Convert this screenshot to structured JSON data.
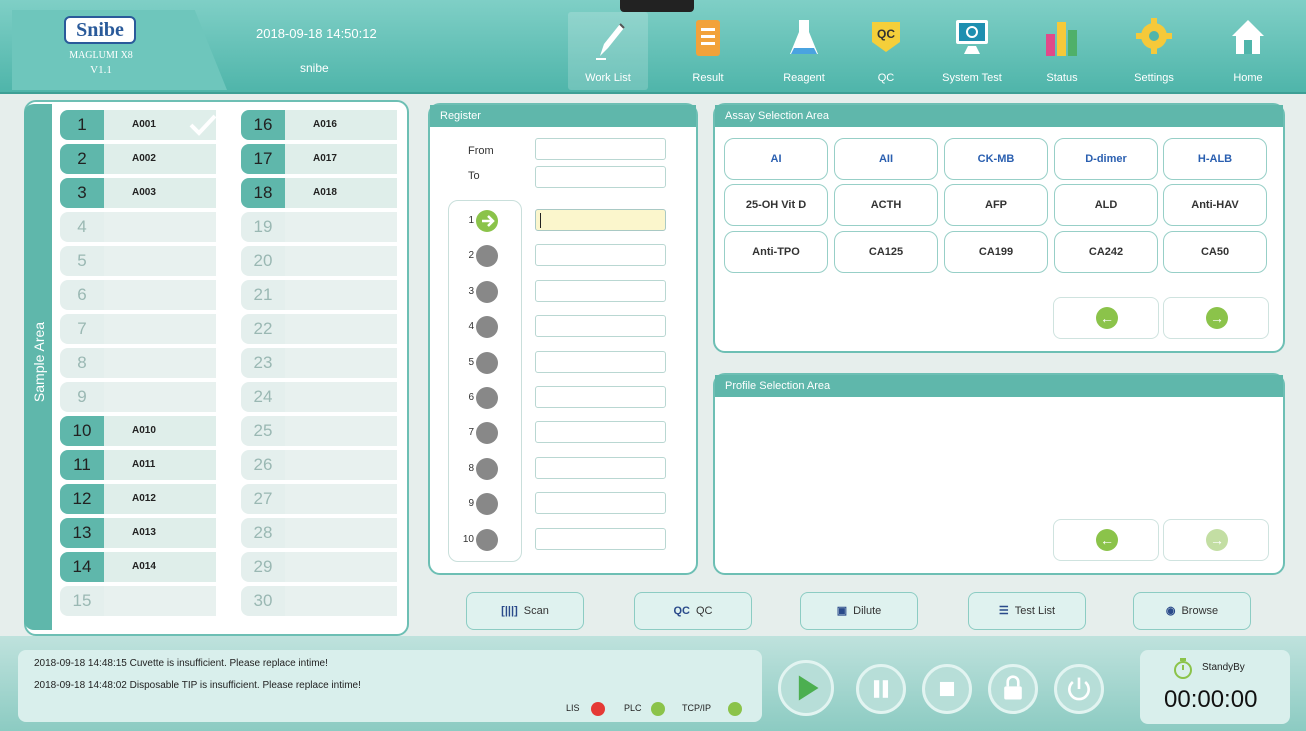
{
  "header": {
    "logo": "Snibe",
    "model": "MAGLUMI X8",
    "version": "V1.1",
    "datetime": "2018-09-18 14:50:12",
    "user": "snibe",
    "nav": [
      {
        "label": "Work List",
        "icon": "pencil-icon",
        "active": true
      },
      {
        "label": "Result",
        "icon": "document-icon"
      },
      {
        "label": "Reagent",
        "icon": "flask-icon"
      },
      {
        "label": "QC",
        "icon": "qc-badge-icon",
        "badge": "QC"
      },
      {
        "label": "System Test",
        "icon": "monitor-icon"
      },
      {
        "label": "Status",
        "icon": "bar-chart-icon"
      },
      {
        "label": "Settings",
        "icon": "gear-icon"
      },
      {
        "label": "Home",
        "icon": "home-icon"
      }
    ]
  },
  "sample_area": {
    "label": "Sample Area",
    "col1": [
      {
        "n": "1",
        "id": "A001",
        "checked": true
      },
      {
        "n": "2",
        "id": "A002"
      },
      {
        "n": "3",
        "id": "A003"
      },
      {
        "n": "4",
        "id": ""
      },
      {
        "n": "5",
        "id": ""
      },
      {
        "n": "6",
        "id": ""
      },
      {
        "n": "7",
        "id": ""
      },
      {
        "n": "8",
        "id": ""
      },
      {
        "n": "9",
        "id": ""
      },
      {
        "n": "10",
        "id": "A010"
      },
      {
        "n": "11",
        "id": "A011"
      },
      {
        "n": "12",
        "id": "A012"
      },
      {
        "n": "13",
        "id": "A013"
      },
      {
        "n": "14",
        "id": "A014"
      },
      {
        "n": "15",
        "id": ""
      }
    ],
    "col2": [
      {
        "n": "16",
        "id": "A016"
      },
      {
        "n": "17",
        "id": "A017"
      },
      {
        "n": "18",
        "id": "A018"
      },
      {
        "n": "19",
        "id": ""
      },
      {
        "n": "20",
        "id": ""
      },
      {
        "n": "21",
        "id": ""
      },
      {
        "n": "22",
        "id": ""
      },
      {
        "n": "23",
        "id": ""
      },
      {
        "n": "24",
        "id": ""
      },
      {
        "n": "25",
        "id": ""
      },
      {
        "n": "26",
        "id": ""
      },
      {
        "n": "27",
        "id": ""
      },
      {
        "n": "28",
        "id": ""
      },
      {
        "n": "29",
        "id": ""
      },
      {
        "n": "30",
        "id": ""
      }
    ]
  },
  "register": {
    "title": "Register",
    "from_label": "From",
    "to_label": "To",
    "from_value": "",
    "to_value": "",
    "rows": [
      "1",
      "2",
      "3",
      "4",
      "5",
      "6",
      "7",
      "8",
      "9",
      "10"
    ],
    "row_values": [
      "",
      "",
      "",
      "",
      "",
      "",
      "",
      "",
      "",
      ""
    ]
  },
  "assay": {
    "title": "Assay Selection Area",
    "tests": [
      {
        "label": "AI",
        "blue": true
      },
      {
        "label": "AII",
        "blue": true
      },
      {
        "label": "CK-MB",
        "blue": true
      },
      {
        "label": "D-dimer",
        "blue": true
      },
      {
        "label": "H-ALB",
        "blue": true
      },
      {
        "label": "25-OH Vit D"
      },
      {
        "label": "ACTH"
      },
      {
        "label": "AFP"
      },
      {
        "label": "ALD"
      },
      {
        "label": "Anti-HAV"
      },
      {
        "label": "Anti-TPO"
      },
      {
        "label": "CA125"
      },
      {
        "label": "CA199"
      },
      {
        "label": "CA242"
      },
      {
        "label": "CA50"
      }
    ],
    "prev_icon": "arrow-left-icon",
    "next_icon": "arrow-right-icon"
  },
  "profile": {
    "title": "Profile Selection Area"
  },
  "toolbar": [
    {
      "label": "Scan",
      "icon": "barcode-icon",
      "glyph": "[|||]"
    },
    {
      "label": "QC",
      "icon": "qc-icon",
      "glyph": "QC"
    },
    {
      "label": "Dilute",
      "icon": "dilute-icon",
      "glyph": "▣"
    },
    {
      "label": "Test List",
      "icon": "list-icon",
      "glyph": "☰"
    },
    {
      "label": "Browse",
      "icon": "eye-icon",
      "glyph": "◉"
    }
  ],
  "messages": [
    "2018-09-18 14:48:15  Cuvette is insufficient. Please replace intime!",
    "2018-09-18 14:48:02  Disposable TIP is insufficient. Please replace intime!"
  ],
  "status": [
    {
      "label": "LIS",
      "color": "#e53935"
    },
    {
      "label": "PLC",
      "color": "#8bc34a"
    },
    {
      "label": "TCP/IP",
      "color": "#8bc34a"
    }
  ],
  "state": "StandyBy",
  "timer": "00:00:00"
}
